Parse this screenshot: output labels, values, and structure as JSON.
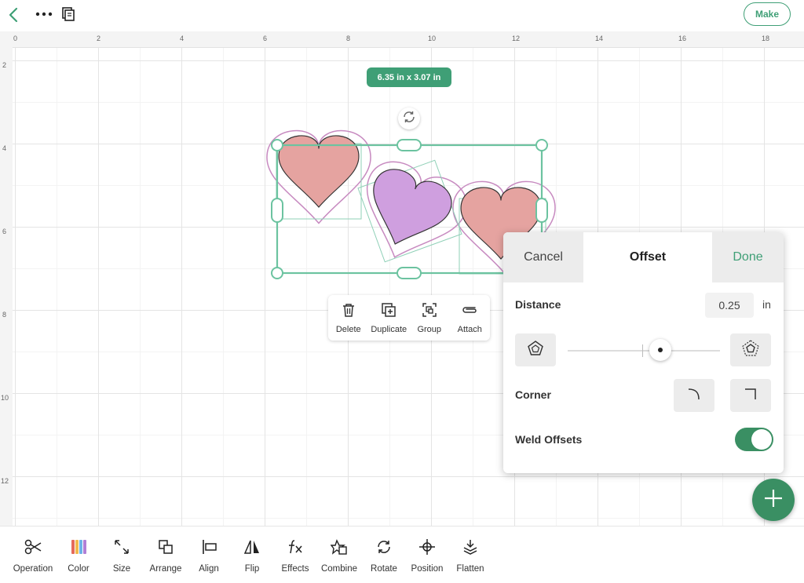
{
  "topbar": {
    "make_label": "Make"
  },
  "ruler": {
    "top_ticks": [
      "0",
      "2",
      "4",
      "6",
      "8",
      "10",
      "12",
      "14",
      "16",
      "18"
    ],
    "left_ticks": [
      "2",
      "4",
      "6",
      "8",
      "10",
      "12"
    ]
  },
  "selection": {
    "size_label": "6.35 in x 3.07 in"
  },
  "context_menu": {
    "items": [
      {
        "label": "Delete",
        "icon": "trash-icon"
      },
      {
        "label": "Duplicate",
        "icon": "duplicate-icon"
      },
      {
        "label": "Group",
        "icon": "group-icon"
      },
      {
        "label": "Attach",
        "icon": "paperclip-icon"
      }
    ]
  },
  "offset_panel": {
    "cancel_label": "Cancel",
    "title": "Offset",
    "done_label": "Done",
    "distance_label": "Distance",
    "distance_value": "0.25",
    "distance_unit": "in",
    "corner_label": "Corner",
    "weld_label": "Weld Offsets",
    "weld_on": true,
    "slider_value": 0.61
  },
  "toolbar": {
    "items": [
      {
        "label": "Operation",
        "icon": "scissors-icon"
      },
      {
        "label": "Color",
        "icon": "color-icon"
      },
      {
        "label": "Size",
        "icon": "resize-icon"
      },
      {
        "label": "Arrange",
        "icon": "arrange-icon"
      },
      {
        "label": "Align",
        "icon": "align-icon"
      },
      {
        "label": "Flip",
        "icon": "flip-icon"
      },
      {
        "label": "Effects",
        "icon": "fx-icon"
      },
      {
        "label": "Combine",
        "icon": "combine-icon"
      },
      {
        "label": "Rotate",
        "icon": "rotate-icon"
      },
      {
        "label": "Position",
        "icon": "position-icon"
      },
      {
        "label": "Flatten",
        "icon": "flatten-icon"
      }
    ]
  },
  "colors": {
    "accent": "#3f9f76",
    "heart_pink": "#e5a3a0",
    "heart_purple": "#cf9fdf",
    "offset_outline": "#c78ac0"
  }
}
